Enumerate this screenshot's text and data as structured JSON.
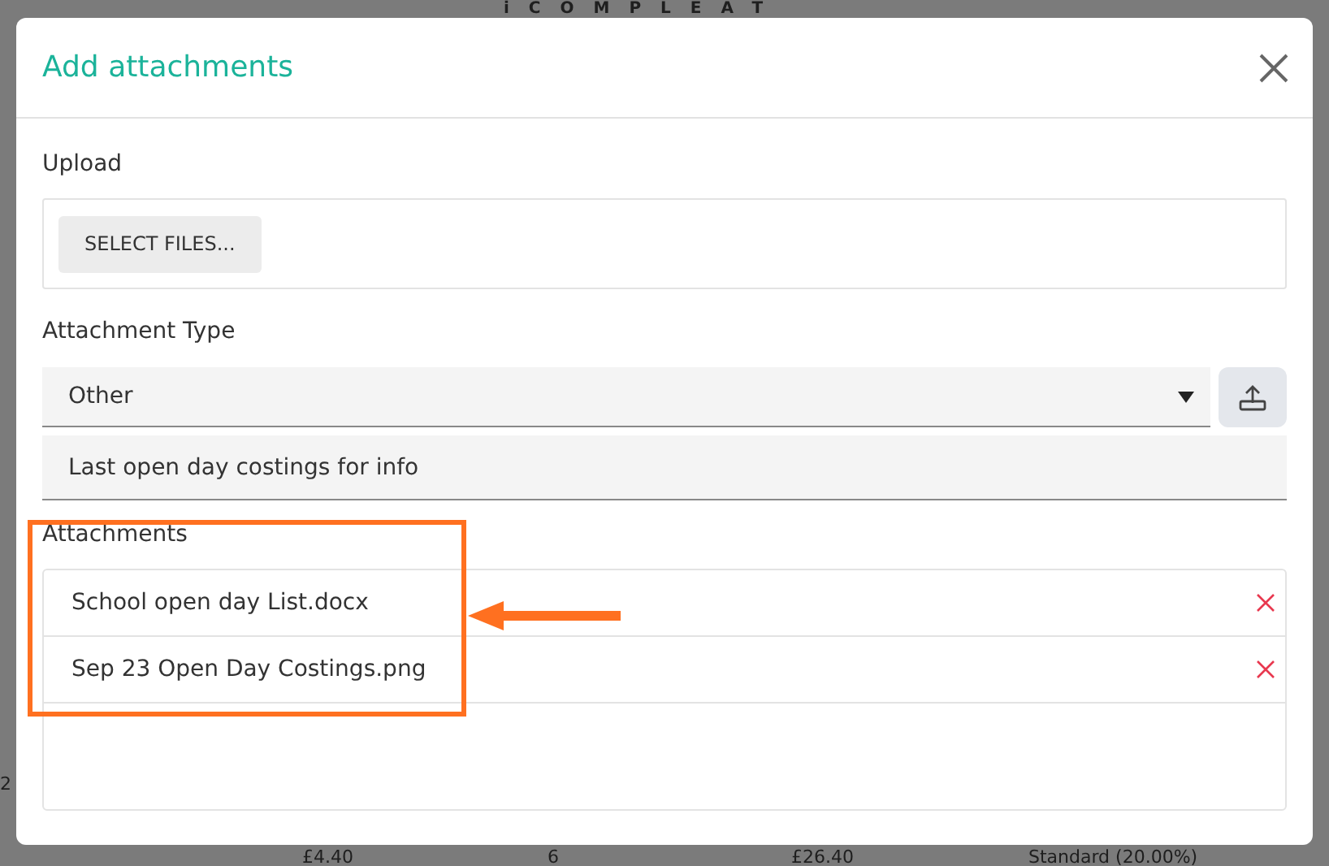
{
  "background": {
    "logo": "iCOMPLEAT",
    "row_start": "2",
    "row": [
      "£4.40",
      "6",
      "£26.40",
      "Standard (20.00%)"
    ]
  },
  "dialog": {
    "title": "Add attachments",
    "upload": {
      "label": "Upload",
      "button": "SELECT FILES..."
    },
    "attachment_type": {
      "label": "Attachment Type",
      "value": "Other"
    },
    "description": {
      "value": "Last open day costings for info"
    },
    "attachments": {
      "label": "Attachments",
      "files": [
        {
          "name": "School open day List.docx"
        },
        {
          "name": "Sep 23 Open Day Costings.png"
        }
      ]
    }
  },
  "annotations": [
    {
      "kind": "frame"
    },
    {
      "kind": "arrow"
    }
  ]
}
